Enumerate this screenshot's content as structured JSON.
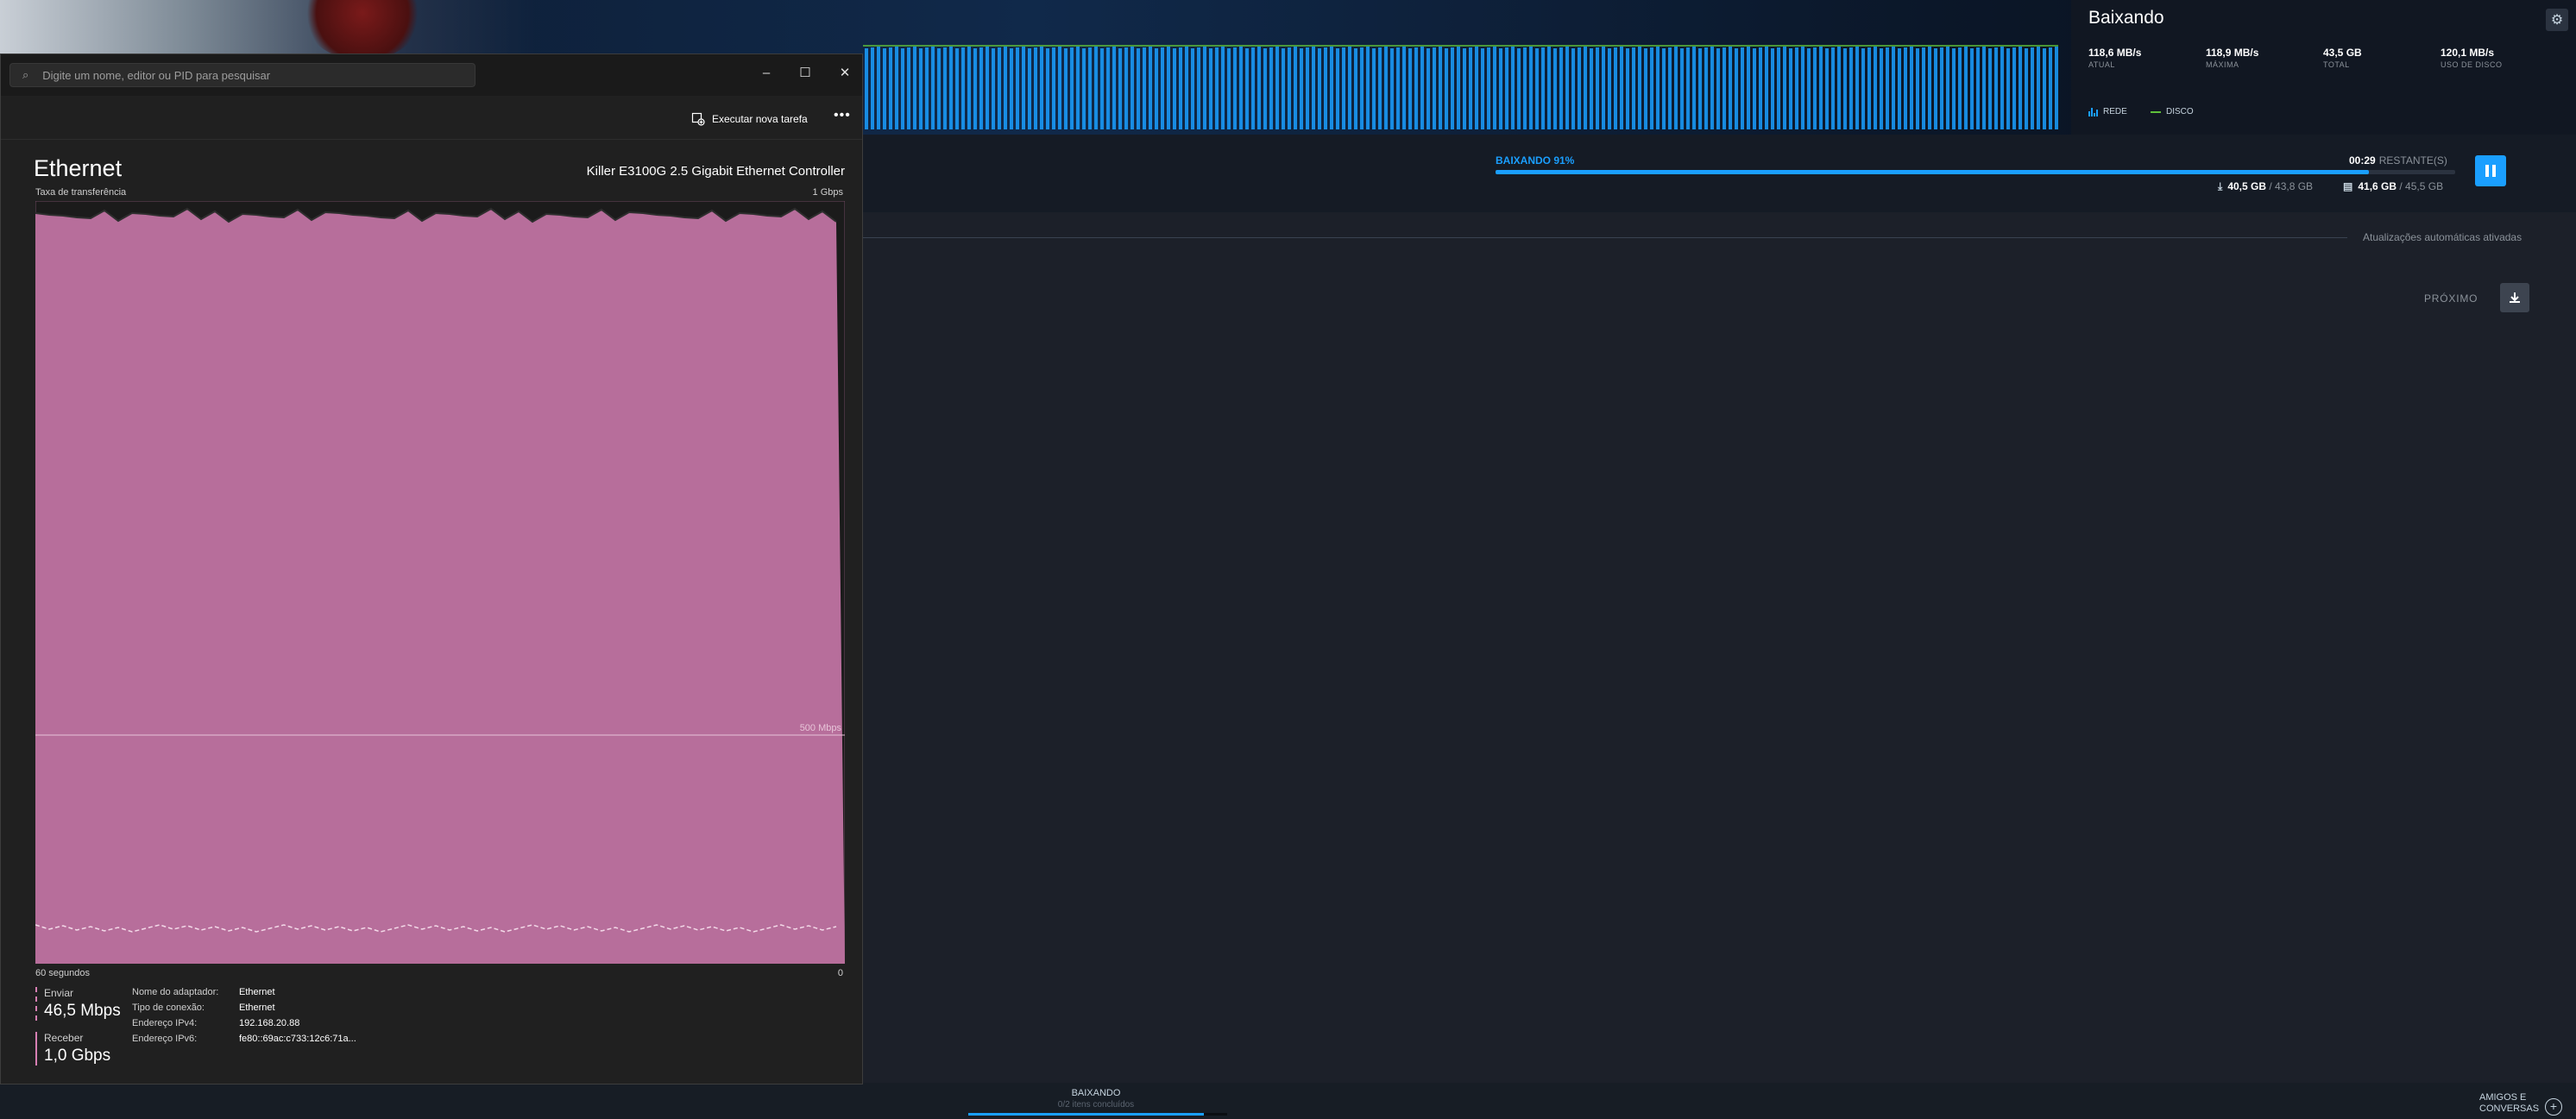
{
  "steam": {
    "header": {
      "title": "Baixando",
      "stats": [
        {
          "value": "118,6 MB/s",
          "label": "ATUAL"
        },
        {
          "value": "118,9 MB/s",
          "label": "MÁXIMA"
        },
        {
          "value": "43,5 GB",
          "label": "TOTAL"
        },
        {
          "value": "120,1 MB/s",
          "label": "USO DE DISCO"
        }
      ],
      "legend": {
        "network": "REDE",
        "disk": "DISCO"
      },
      "colors": {
        "network_bars": "#1a9fff",
        "disk_line": "#5fbf3a"
      }
    },
    "current": {
      "status": "BAIXANDO 91%",
      "progress": 0.91,
      "time": "00:29",
      "time_label": "RESTANTE(S)",
      "downloaded": "40,5 GB",
      "download_total": "/ 43,8 GB",
      "disk": "41,6 GB",
      "disk_total": "/ 45,5 GB"
    },
    "auto_updates": "Atualizações automáticas ativadas",
    "next_label": "PRÓXIMO",
    "bottom": {
      "status": "BAIXANDO",
      "substatus": "0/2 itens concluídos",
      "friends_line1": "AMIGOS E",
      "friends_line2": "CONVERSAS"
    }
  },
  "task_manager": {
    "search_placeholder": "Digite um nome, editor ou PID para pesquisar",
    "run_task_label": "Executar nova tarefa",
    "title": "Ethernet",
    "adapter": "Killer E3100G 2.5 Gigabit Ethernet Controller",
    "throughput_label": "Taxa de transferência",
    "scale_max": "1 Gbps",
    "scale_mid": "500 Mbps",
    "axis_left": "60 segundos",
    "axis_right": "0",
    "send_label": "Enviar",
    "send_value": "46,5 Mbps",
    "receive_label": "Receber",
    "receive_value": "1,0 Gbps",
    "properties": [
      {
        "label": "Nome do adaptador:",
        "value": "Ethernet"
      },
      {
        "label": "Tipo de conexão:",
        "value": "Ethernet"
      },
      {
        "label": "Endereço IPv4:",
        "value": "192.168.20.88"
      },
      {
        "label": "Endereço IPv6:",
        "value": "fe80::69ac:c733:12c6:71a..."
      }
    ],
    "colors": {
      "fill": "#b76e9b",
      "line": "#d77fb3"
    }
  }
}
